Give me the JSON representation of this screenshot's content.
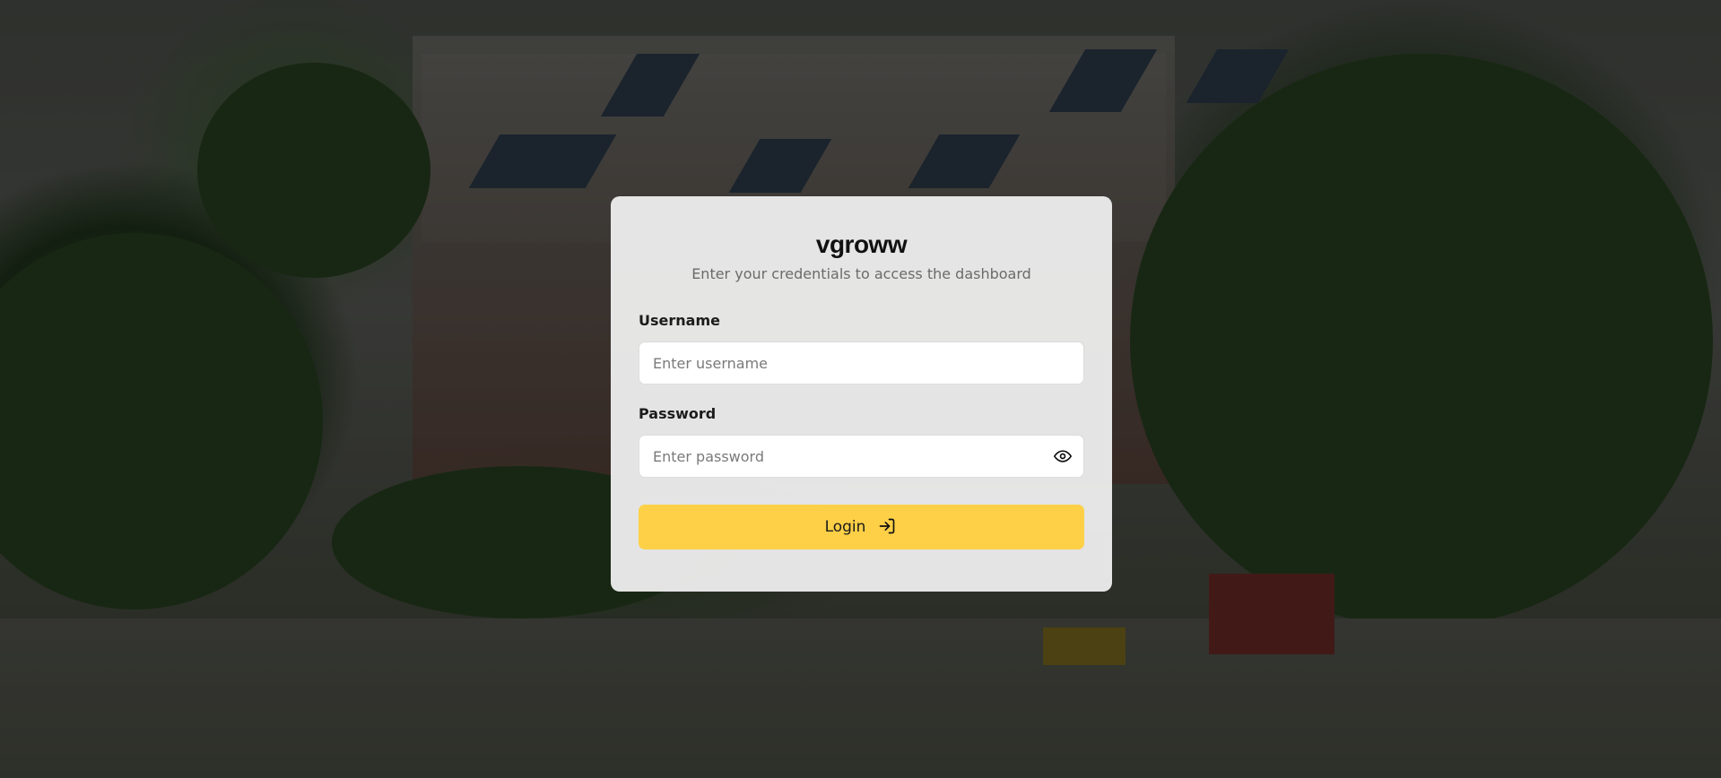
{
  "brand": {
    "name": "vgroww",
    "subtitle": "Enter your credentials to access the dashboard"
  },
  "form": {
    "username": {
      "label": "Username",
      "value": "",
      "placeholder": "Enter username"
    },
    "password": {
      "label": "Password",
      "value": "",
      "placeholder": "Enter password",
      "toggle_icon": "eye-icon"
    },
    "submit": {
      "label": "Login",
      "icon": "log-in-arrow-icon"
    }
  },
  "colors": {
    "accent": "#fdd047",
    "card_background": "#f0f0f0",
    "title_text": "#111111",
    "subtitle_text": "#6b6b6b"
  }
}
